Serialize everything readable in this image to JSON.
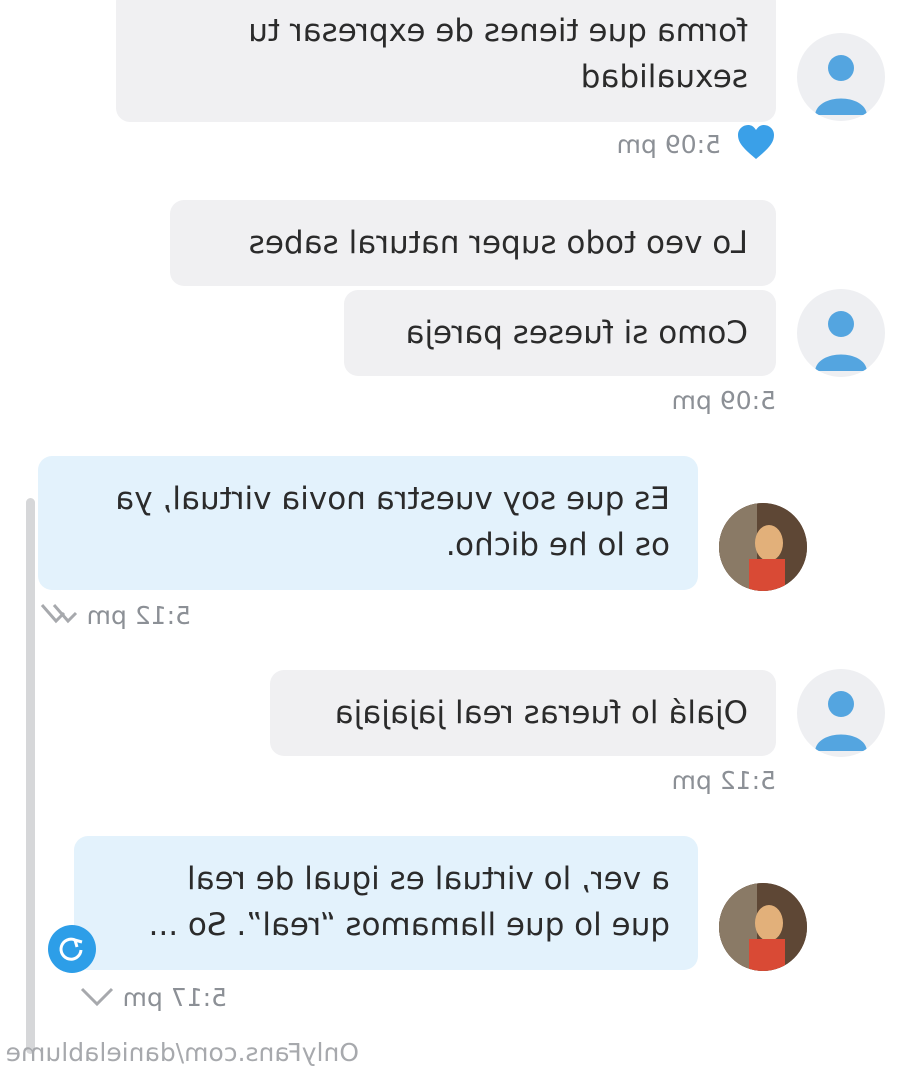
{
  "messages": [
    {
      "lines": [
        "forma que tienes de expresar tu",
        "sexualidad"
      ],
      "time": "5:09 pm",
      "liked": true
    },
    {
      "lines": [
        "Lo veo todo super natural sabes"
      ]
    },
    {
      "lines": [
        "Como si fueses pareja"
      ],
      "time": "5:09 pm"
    },
    {
      "lines": [
        "Es que soy vuestra novia virtual, ya",
        "os lo he dicho."
      ],
      "time": "5:12 pm"
    },
    {
      "lines": [
        "Ojalá lo fueras real jajajaja"
      ],
      "time": "5:12 pm"
    },
    {
      "lines": [
        "a ver, lo virtual es igual de real",
        "que lo que llamamos “real”. So ..."
      ],
      "time": "5:17 pm"
    }
  ],
  "watermark": "OnlyFans.com/danielablume",
  "colors": {
    "incoming_bubble": "#f0f0f2",
    "outgoing_bubble": "#e3f2fc",
    "accent": "#2d9ee8",
    "timestamp": "#8c9096"
  },
  "icons": [
    "user-avatar-icon",
    "heart-icon",
    "double-check-icon",
    "chevron-down-icon",
    "scroll-down-icon"
  ]
}
